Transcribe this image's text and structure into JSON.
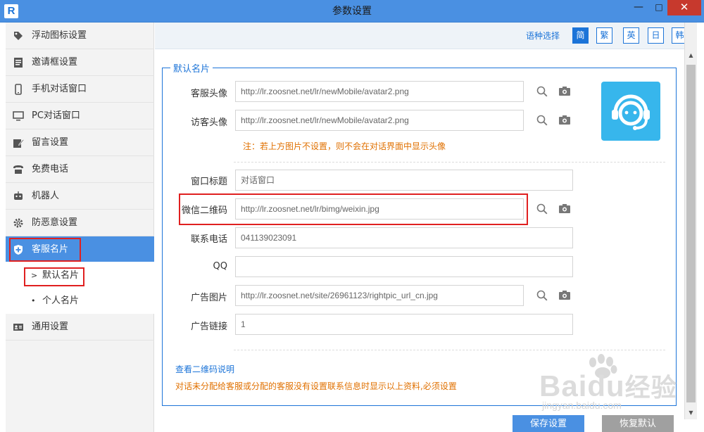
{
  "window": {
    "title": "参数设置",
    "logo": "R",
    "min": "—",
    "max": "□",
    "close": "✕"
  },
  "sidebar": {
    "items": [
      {
        "label": "浮动图标设置",
        "icon": "tag-icon"
      },
      {
        "label": "邀请框设置",
        "icon": "invite-box-icon"
      },
      {
        "label": "手机对话窗口",
        "icon": "phone-icon"
      },
      {
        "label": "PC对话窗口",
        "icon": "monitor-icon"
      },
      {
        "label": "留言设置",
        "icon": "message-edit-icon"
      },
      {
        "label": "免费电话",
        "icon": "telephone-icon"
      },
      {
        "label": "机器人",
        "icon": "robot-icon"
      },
      {
        "label": "防恶意设置",
        "icon": "gear-icon"
      },
      {
        "label": "客服名片",
        "icon": "shield-plus-icon"
      },
      {
        "label": "通用设置",
        "icon": "id-card-icon"
      }
    ],
    "sub_items": [
      {
        "label": "默认名片",
        "mark": ">"
      },
      {
        "label": "个人名片",
        "mark": "•"
      }
    ]
  },
  "language": {
    "label": "语种选择",
    "options": [
      "简",
      "繁",
      "英",
      "日",
      "韩"
    ],
    "selected": "简"
  },
  "form": {
    "legend": "默认名片",
    "service_avatar": {
      "label": "客服头像",
      "value": "http://lr.zoosnet.net/lr/newMobile/avatar2.png"
    },
    "visitor_avatar": {
      "label": "访客头像",
      "value": "http://lr.zoosnet.net/lr/newMobile/avatar2.png"
    },
    "avatar_note": "注：若上方图片不设置，则不会在对话界面中显示头像",
    "window_title": {
      "label": "窗口标题",
      "value": "对话窗口"
    },
    "wechat_qr": {
      "label": "微信二维码",
      "value": "http://lr.zoosnet.net/lr/bimg/weixin.jpg"
    },
    "phone": {
      "label": "联系电话",
      "value": "041139023091"
    },
    "qq": {
      "label": "QQ",
      "value": ""
    },
    "ad_image": {
      "label": "广告图片",
      "value": "http://lr.zoosnet.net/site/26961123/rightpic_url_cn.jpg"
    },
    "ad_link": {
      "label": "广告链接",
      "value": "1"
    },
    "qr_help_link": "查看二维码说明",
    "bottom_note": "对话未分配给客服或分配的客服没有设置联系信息时显示以上资料,必须设置"
  },
  "buttons": {
    "save": "保存设置",
    "reset": "恢复默认"
  },
  "watermark": {
    "brand": "Bai",
    "brand2": "du",
    "brand_cn": "经验",
    "url": "jingyan.baidu.com"
  },
  "colors": {
    "accent": "#4a90e2",
    "link": "#1c74d8",
    "note": "#e07000",
    "highlight": "#e02020",
    "avatar": "#37b6ec"
  }
}
